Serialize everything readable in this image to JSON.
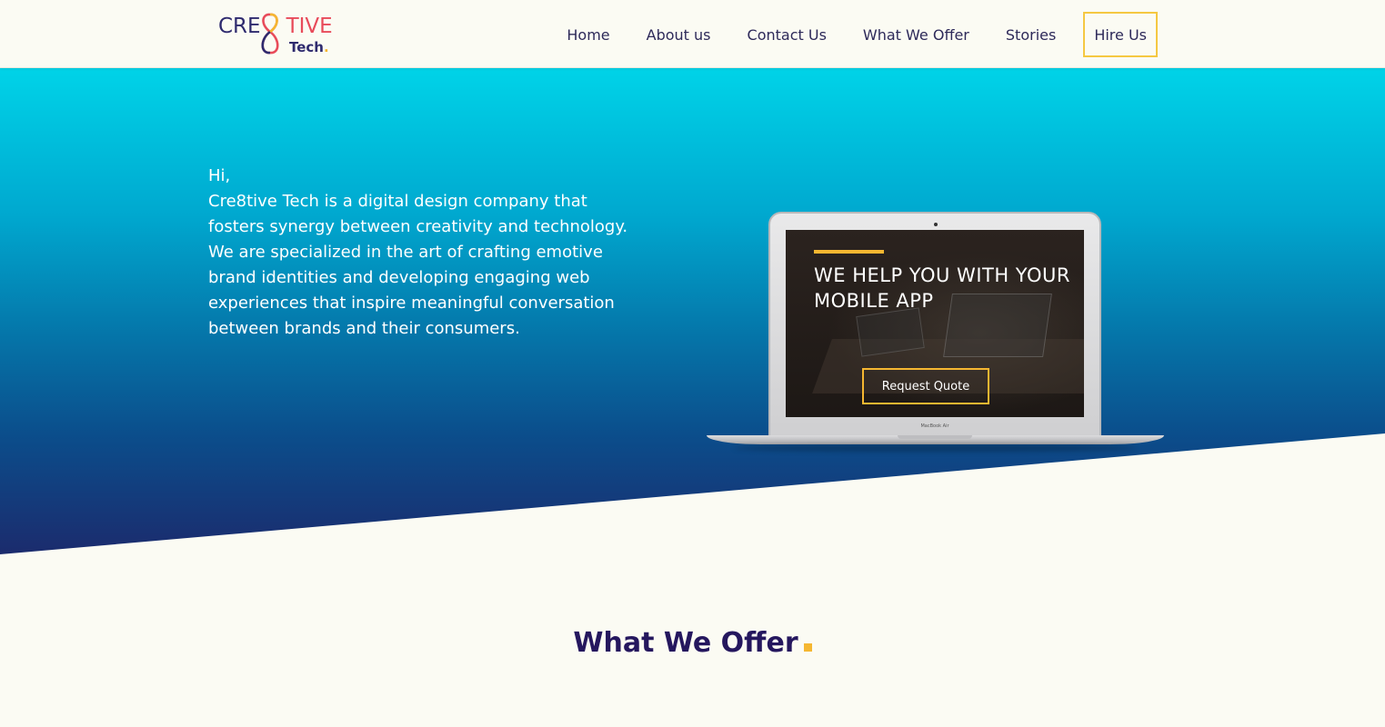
{
  "brand": {
    "word_left": "CRE",
    "word_right": "TIVE",
    "word_bottom": "Tech",
    "dot": ".",
    "colors": {
      "navy": "#2e2a6e",
      "coral": "#e84b5a",
      "gold": "#f5b731"
    }
  },
  "nav": {
    "items": [
      {
        "label": "Home"
      },
      {
        "label": "About us"
      },
      {
        "label": "Contact Us"
      },
      {
        "label": "What We Offer"
      },
      {
        "label": "Stories"
      }
    ],
    "cta_label": "Hire Us",
    "cta_border_color": "#f5c842"
  },
  "hero": {
    "greeting": "Hi,",
    "paragraph": "Cre8tive Tech is a digital design company that fosters synergy between creativity and technology. We are specialized in the art of crafting emotive brand identities and developing engaging web experiences that inspire meaningful conversation between brands and their consumers.",
    "gradient": [
      "#00d3e8",
      "#0574a8",
      "#1c2a6c"
    ]
  },
  "laptop_screen": {
    "headline": "WE HELP YOU WITH YOUR MOBILE APP",
    "button_label": "Request Quote",
    "device_label": "MacBook Air"
  },
  "sections": {
    "offer_title": "What We Offer"
  }
}
